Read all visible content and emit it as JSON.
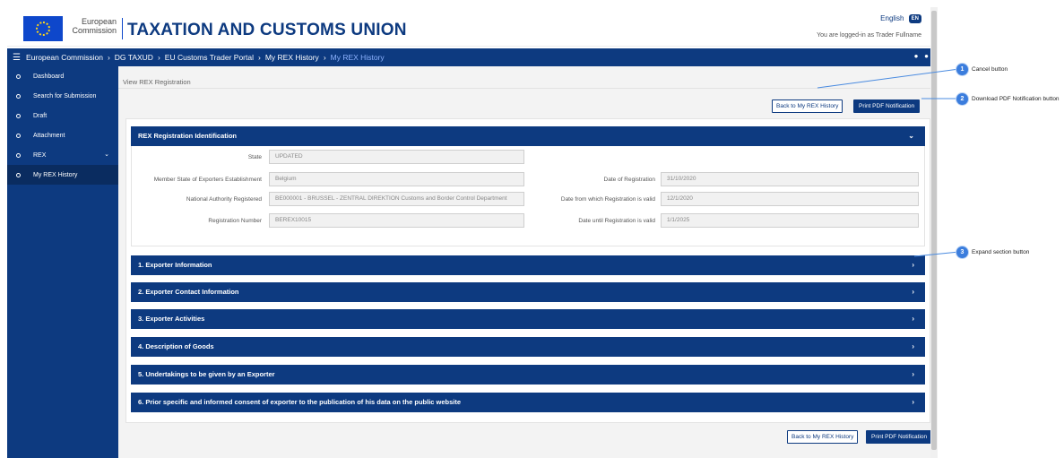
{
  "header": {
    "org_line1": "European",
    "org_line2": "Commission",
    "site_title": "TAXATION AND CUSTOMS UNION",
    "language": "English",
    "language_code": "EN",
    "logged_in_text": "You are logged-in as Trader Fullname"
  },
  "breadcrumb": {
    "items": [
      "European Commission",
      "DG TAXUD",
      "EU Customs Trader Portal",
      "My REX History",
      "My REX History"
    ]
  },
  "sidebar": {
    "items": [
      {
        "label": "Dashboard"
      },
      {
        "label": "Search for Submission"
      },
      {
        "label": "Draft"
      },
      {
        "label": "Attachment"
      },
      {
        "label": "REX"
      },
      {
        "label": "My REX History"
      }
    ],
    "active_index": 5
  },
  "page": {
    "title": "View REX Registration",
    "back_button": "Back to My REX History",
    "print_button": "Print PDF Notification"
  },
  "identification": {
    "title": "REX Registration Identification",
    "state_label": "State",
    "state_value": "UPDATED",
    "member_state_label": "Member State of Exporters Establishment",
    "member_state_value": "Belgium",
    "authority_label": "National Authority Registered",
    "authority_value": "BE000001 - BRUSSEL - ZENTRAL DIREKTION Customs and Border Control Department",
    "reg_number_label": "Registration Number",
    "reg_number_value": "BEREX10015",
    "date_reg_label": "Date of Registration",
    "date_reg_value": "31/10/2020",
    "date_from_label": "Date from which Registration is valid",
    "date_from_value": "12/1/2020",
    "date_until_label": "Date until Registration is valid",
    "date_until_value": "1/1/2025"
  },
  "sections": [
    {
      "title": "1. Exporter Information"
    },
    {
      "title": "2. Exporter Contact Information"
    },
    {
      "title": "3. Exporter Activities"
    },
    {
      "title": "4. Description of Goods"
    },
    {
      "title": "5. Undertakings to be given by an Exporter"
    },
    {
      "title": "6. Prior specific and informed consent of exporter to the publication of his data on the public website"
    }
  ],
  "callouts": [
    {
      "number": "1",
      "label": "Cancel button"
    },
    {
      "number": "2",
      "label": "Download PDF Notification button"
    },
    {
      "number": "3",
      "label": "Expand section button"
    }
  ],
  "colors": {
    "brand_blue": "#0d3a80",
    "callout_blue": "#3b7ddd"
  }
}
